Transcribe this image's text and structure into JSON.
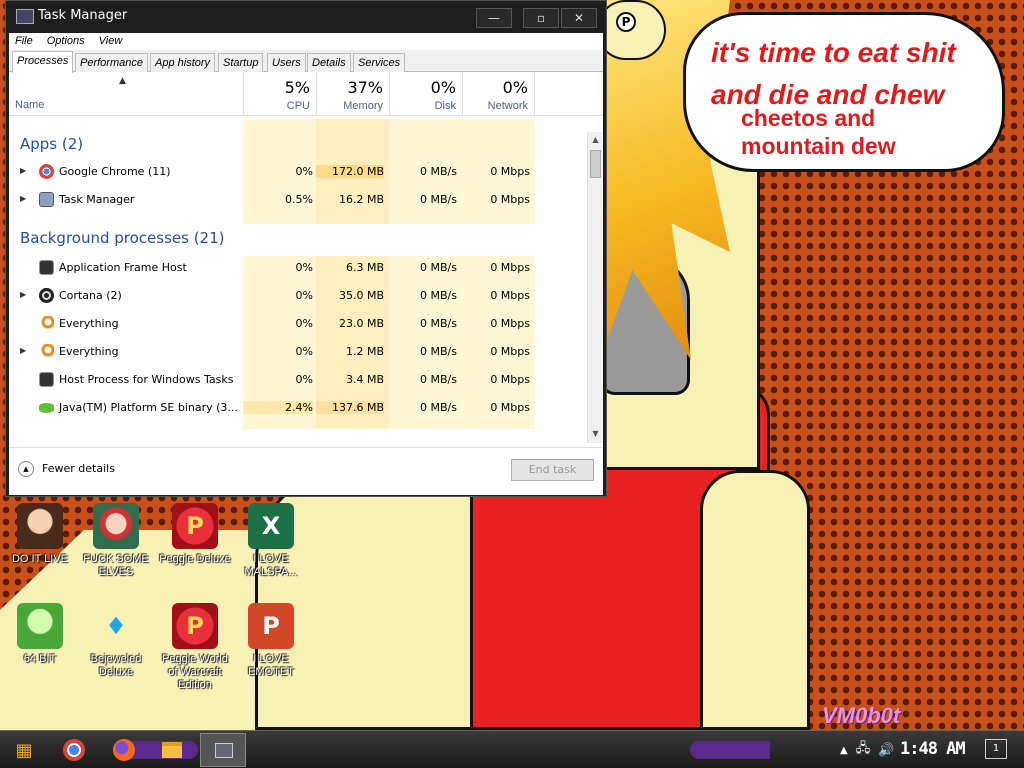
{
  "wallpaper": {
    "speech": {
      "line1": "it's time to eat shit",
      "line2": "and die and chew",
      "line3": "cheetos and",
      "line4": "mountain dew"
    },
    "watermark": "VM0b0t"
  },
  "desktop_icons": [
    {
      "label": "DO IT LIVE",
      "icon": "portrait-icon"
    },
    {
      "label": "FUCK SOME ELVES",
      "icon": "elf-icon"
    },
    {
      "label": "Peggle Deluxe",
      "icon": "peggle-icon"
    },
    {
      "label": "I LOVE MALSPA...",
      "icon": "excel-icon"
    },
    {
      "label": "64 BIT",
      "icon": "peridot-icon"
    },
    {
      "label": "Bejeweled Deluxe",
      "icon": "gem-icon"
    },
    {
      "label": "Peggle World of Warcraft Edition",
      "icon": "peggle-icon"
    },
    {
      "label": "I LOVE EMOTET",
      "icon": "powerpoint-icon"
    }
  ],
  "task_manager": {
    "title": "Task Manager",
    "menu": [
      "File",
      "Options",
      "View"
    ],
    "tabs": [
      "Processes",
      "Performance",
      "App history",
      "Startup",
      "Users",
      "Details",
      "Services"
    ],
    "active_tab": "Processes",
    "columns": {
      "name": "Name",
      "cpu": {
        "pct": "5%",
        "label": "CPU"
      },
      "memory": {
        "pct": "37%",
        "label": "Memory"
      },
      "disk": {
        "pct": "0%",
        "label": "Disk"
      },
      "network": {
        "pct": "0%",
        "label": "Network"
      }
    },
    "groups": {
      "apps": "Apps (2)",
      "background": "Background processes (21)"
    },
    "processes": [
      {
        "name": "Google Chrome (11)",
        "cpu": "0%",
        "mem": "172.0 MB",
        "disk": "0 MB/s",
        "net": "0 Mbps",
        "expandable": true,
        "icon": "chrome-icon"
      },
      {
        "name": "Task Manager",
        "cpu": "0.5%",
        "mem": "16.2 MB",
        "disk": "0 MB/s",
        "net": "0 Mbps",
        "expandable": true,
        "icon": "task-manager-icon"
      },
      {
        "name": "Application Frame Host",
        "cpu": "0%",
        "mem": "6.3 MB",
        "disk": "0 MB/s",
        "net": "0 Mbps",
        "expandable": false,
        "icon": "app-frame-icon"
      },
      {
        "name": "Cortana (2)",
        "cpu": "0%",
        "mem": "35.0 MB",
        "disk": "0 MB/s",
        "net": "0 Mbps",
        "expandable": true,
        "icon": "cortana-icon"
      },
      {
        "name": "Everything",
        "cpu": "0%",
        "mem": "23.0 MB",
        "disk": "0 MB/s",
        "net": "0 Mbps",
        "expandable": false,
        "icon": "magnifier-icon"
      },
      {
        "name": "Everything",
        "cpu": "0%",
        "mem": "1.2 MB",
        "disk": "0 MB/s",
        "net": "0 Mbps",
        "expandable": true,
        "icon": "magnifier-icon"
      },
      {
        "name": "Host Process for Windows Tasks",
        "cpu": "0%",
        "mem": "3.4 MB",
        "disk": "0 MB/s",
        "net": "0 Mbps",
        "expandable": false,
        "icon": "host-process-icon"
      },
      {
        "name": "Java(TM) Platform SE binary (3...",
        "cpu": "2.4%",
        "mem": "137.6 MB",
        "disk": "0 MB/s",
        "net": "0 Mbps",
        "expandable": true,
        "icon": "java-icon"
      }
    ],
    "footer": {
      "fewer_details": "Fewer details",
      "end_task": "End task"
    }
  },
  "taskbar": {
    "clock": "1:48 AM",
    "notification_count": "1",
    "pinned": [
      "start-icon",
      "chrome-icon",
      "firefox-icon",
      "file-explorer-icon",
      "task-manager-icon"
    ]
  },
  "colors": {
    "wallpaper_orange": "#c9501a",
    "shirt_red": "#e82222",
    "speech_red": "#e01a1a",
    "group_blue": "#1f4f9e",
    "heat_light": "#fff6d6",
    "heat_mid": "#ffe9a8"
  }
}
